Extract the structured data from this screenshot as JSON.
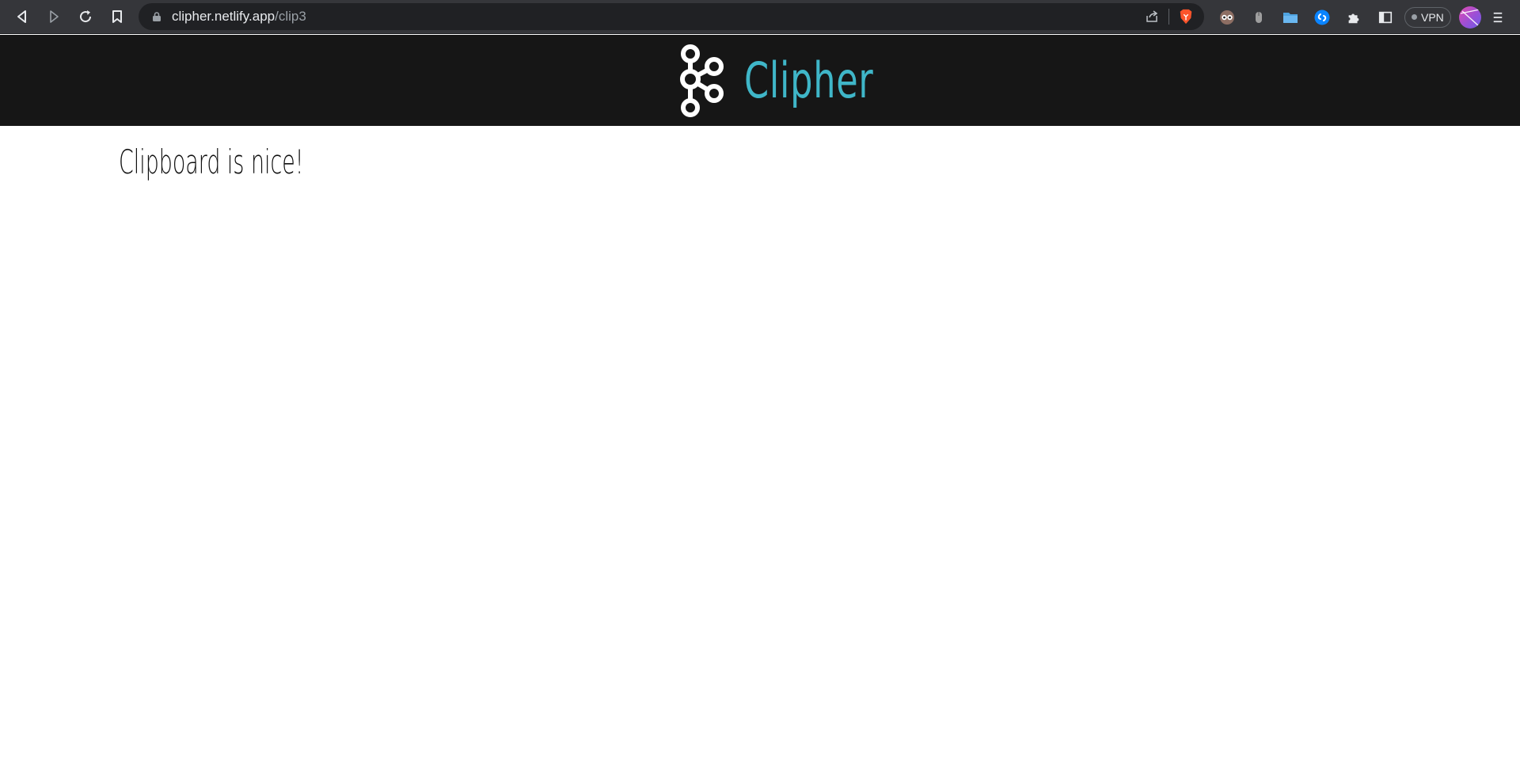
{
  "browser": {
    "url_host": "clipher.netlify.app",
    "url_path": "/clip3",
    "vpn_label": "VPN"
  },
  "site": {
    "brand_name": "Clipher",
    "brand_color": "#3fb6c8",
    "header_bg": "#161616"
  },
  "clip": {
    "content": "Clipboard is nice!"
  },
  "icons": {
    "back": "back-icon",
    "forward": "forward-icon",
    "reload": "reload-icon",
    "bookmark": "bookmark-icon",
    "lock": "lock-icon",
    "share": "share-icon",
    "brave": "brave-shield-icon",
    "extensions": [
      "owl-extension-icon",
      "mouse-extension-icon",
      "folder-extension-icon",
      "shazam-extension-icon",
      "puzzle-extensions-icon",
      "sidebar-icon"
    ],
    "menu": "menu-icon"
  }
}
